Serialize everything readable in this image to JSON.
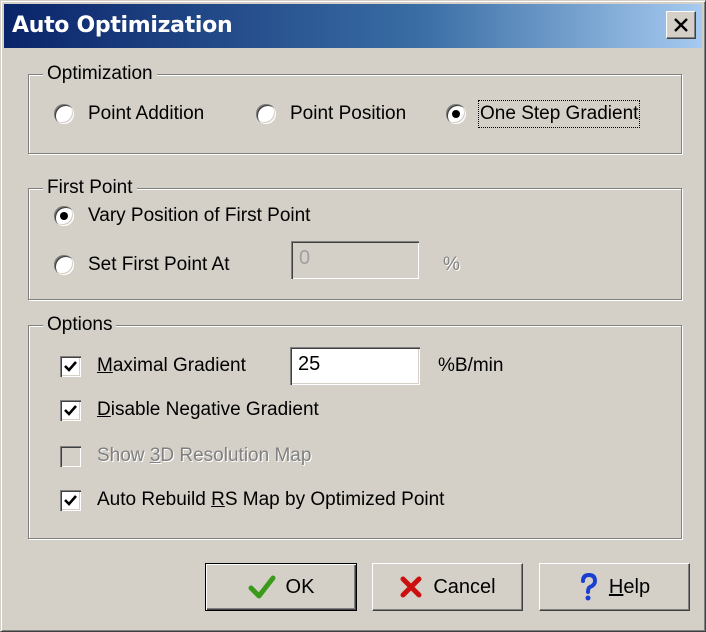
{
  "window": {
    "title": "Auto Optimization",
    "close_symbol": "×"
  },
  "optimization": {
    "group_label": "Optimization",
    "options": [
      {
        "label": "Point Addition",
        "selected": false
      },
      {
        "label": "Point Position",
        "selected": false
      },
      {
        "label": "One Step Gradient",
        "selected": true
      }
    ]
  },
  "first_point": {
    "group_label": "First Point",
    "vary_label": "Vary Position of First Point",
    "vary_selected": true,
    "set_label": "Set First Point At",
    "set_selected": false,
    "set_value": "0",
    "set_unit": "%"
  },
  "options": {
    "group_label": "Options",
    "maximal_gradient": {
      "prefix": "",
      "mnemonic": "M",
      "rest": "aximal Gradient",
      "checked": true,
      "value": "25",
      "unit": "%B/min"
    },
    "disable_negative": {
      "prefix": "",
      "mnemonic": "D",
      "rest": "isable Negative Gradient",
      "checked": true
    },
    "show_3d": {
      "prefix": "Show ",
      "mnemonic": "3",
      "rest": "D Resolution Map",
      "checked": false,
      "enabled": false
    },
    "auto_rebuild": {
      "prefix": "Auto Rebuild ",
      "mnemonic": "R",
      "rest": "S Map by Optimized Point",
      "checked": true
    }
  },
  "buttons": {
    "ok": "OK",
    "cancel": "Cancel",
    "help_mnemonic": "H",
    "help_rest": "elp"
  },
  "icons": {
    "ok": "checkmark-icon",
    "cancel": "x-mark-icon",
    "help": "question-mark-icon",
    "close": "close-icon"
  },
  "colors": {
    "title_gradient_start": "#0a246a",
    "title_gradient_end": "#a6caf0",
    "face": "#d4d0c8",
    "ok_icon": "#3a9a1a",
    "cancel_icon": "#cc1010",
    "help_icon": "#1a3fd0"
  }
}
